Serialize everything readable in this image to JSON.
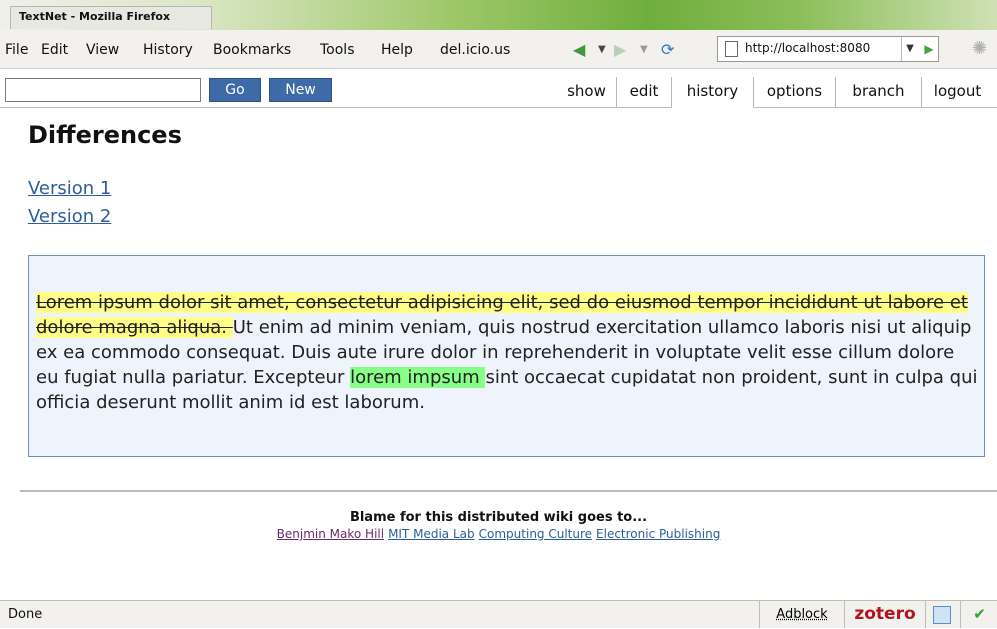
{
  "window": {
    "title": "TextNet - Mozilla Firefox"
  },
  "menu": {
    "items": [
      "File",
      "Edit",
      "View",
      "History",
      "Bookmarks",
      "Tools",
      "Help",
      "del.icio.us"
    ]
  },
  "nav": {
    "back_icon": "back-arrow-icon",
    "forward_icon": "forward-arrow-icon",
    "reload_icon": "reload-icon",
    "url": "http://localhost:8080"
  },
  "wiki": {
    "search": {
      "value": ""
    },
    "go_label": "Go",
    "new_label": "New",
    "tabs": [
      "show",
      "edit",
      "history",
      "options",
      "branch",
      "logout"
    ],
    "active_tab": "history"
  },
  "page": {
    "title": "Differences",
    "version_links": [
      "Version 1",
      "Version 2"
    ],
    "diff": {
      "deleted": "Lorem ipsum dolor sit amet, consectetur adipisicing elit, sed do eiusmod tempor incididunt ut labore et dolore magna aliqua. ",
      "text1": "Ut enim ad minim veniam, quis nostrud exercitation ullamco laboris nisi ut aliquip ex ea commodo consequat. Duis aute irure dolor in reprehenderit in voluptate velit esse cillum dolore eu fugiat nulla pariatur. Excepteur ",
      "inserted": "lorem impsum ",
      "text2": "sint occaecat cupidatat non proident, sunt in culpa qui officia deserunt mollit anim id est laborum."
    },
    "footer": {
      "blame": "Blame for this distributed wiki goes to...",
      "links": [
        "Benjmin Mako Hill",
        "MIT Media Lab",
        "Computing Culture",
        "Electronic Publishing"
      ]
    }
  },
  "status": {
    "text": "Done",
    "adblock": "Adblock",
    "zotero": "zotero"
  },
  "colors": {
    "accent": "#3e6aa8",
    "deleted_bg": "#ffff88",
    "inserted_bg": "#88ff88",
    "diff_bg": "#eef3fc"
  }
}
